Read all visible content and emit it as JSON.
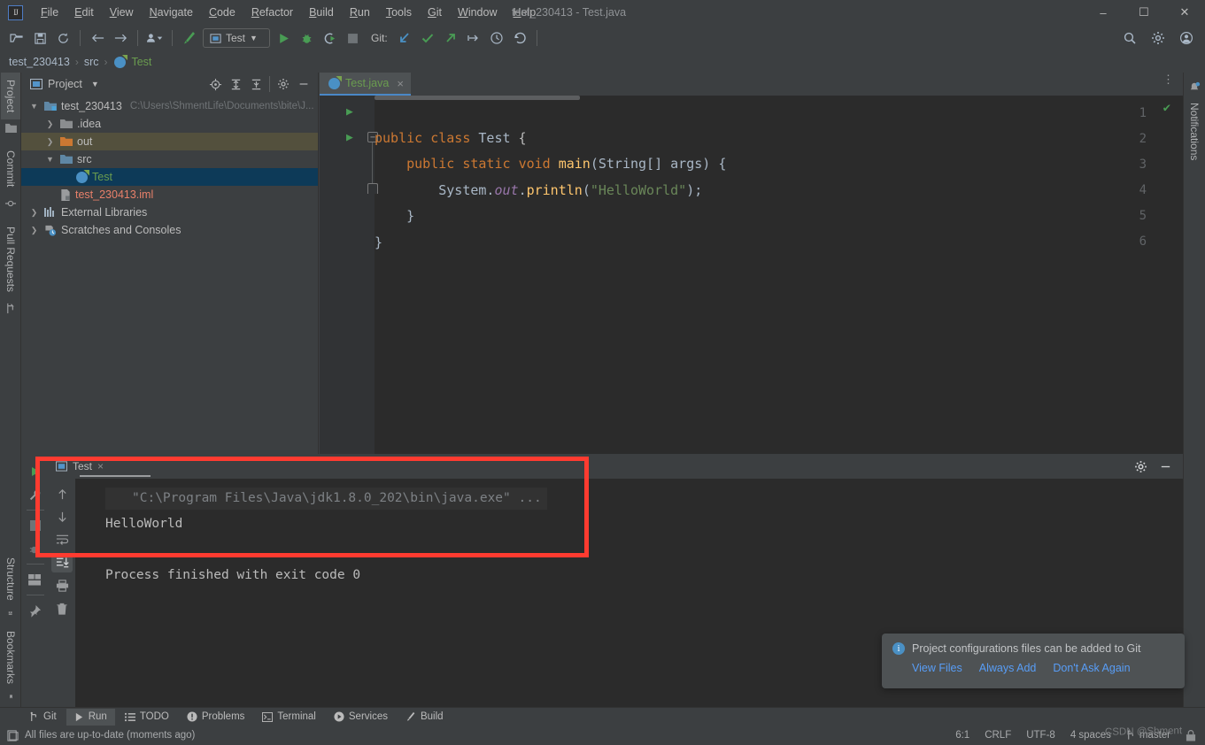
{
  "window": {
    "title": "test_230413 - Test.java",
    "minimize_label": "–",
    "maximize_label": "☐",
    "close_label": "✕"
  },
  "menu": [
    {
      "label": "File"
    },
    {
      "label": "Edit"
    },
    {
      "label": "View"
    },
    {
      "label": "Navigate"
    },
    {
      "label": "Code"
    },
    {
      "label": "Refactor"
    },
    {
      "label": "Build"
    },
    {
      "label": "Run"
    },
    {
      "label": "Tools"
    },
    {
      "label": "Git"
    },
    {
      "label": "Window"
    },
    {
      "label": "Help"
    }
  ],
  "toolbar": {
    "run_config": "Test",
    "git_label": "Git:",
    "icons": {
      "open": "open-folder-icon",
      "save": "save-icon",
      "sync": "sync-icon",
      "back": "back-arrow-icon",
      "forward": "forward-arrow-icon",
      "profile": "user-dropdown-icon",
      "build": "build-hammer-icon",
      "run": "run-icon",
      "debug": "debug-icon",
      "coverage": "run-coverage-icon",
      "stop": "stop-icon",
      "git_update": "git-update-icon",
      "git_commit": "git-commit-icon",
      "git_push": "git-push-icon",
      "git_branch": "git-branch-icon",
      "git_history": "git-history-icon",
      "git_rollback": "git-rollback-icon",
      "search": "search-icon",
      "settings": "settings-gear-icon"
    }
  },
  "breadcrumb": {
    "items": [
      "test_230413",
      "src",
      "Test"
    ],
    "separator": "›"
  },
  "rails": {
    "left_top": [
      "Project",
      "Commit",
      "Pull Requests"
    ],
    "left_bottom": [
      "Structure",
      "Bookmarks"
    ],
    "right": [
      "Notifications"
    ]
  },
  "project_panel": {
    "title": "Project",
    "tree": [
      {
        "label": "test_230413",
        "path": "C:\\Users\\ShmentLife\\Documents\\bite\\J...",
        "indent": 0,
        "arrow": "⌄",
        "icon": "project-folder-icon",
        "state": "normal"
      },
      {
        "label": ".idea",
        "path": "",
        "indent": 1,
        "arrow": "›",
        "icon": "folder-gray-icon",
        "state": "normal"
      },
      {
        "label": "out",
        "path": "",
        "indent": 1,
        "arrow": "›",
        "icon": "folder-orange-icon",
        "state": "highlighted"
      },
      {
        "label": "src",
        "path": "",
        "indent": 1,
        "arrow": "⌄",
        "icon": "folder-blue-icon",
        "state": "normal"
      },
      {
        "label": "Test",
        "path": "",
        "indent": 2,
        "arrow": "",
        "icon": "java-class-icon",
        "state": "selected"
      },
      {
        "label": "test_230413.iml",
        "path": "",
        "indent": 1,
        "arrow": "",
        "icon": "iml-file-icon",
        "state": "normal"
      },
      {
        "label": "External Libraries",
        "path": "",
        "indent": 0,
        "arrow": "›",
        "icon": "libraries-icon",
        "state": "normal"
      },
      {
        "label": "Scratches and Consoles",
        "path": "",
        "indent": 0,
        "arrow": "›",
        "icon": "scratches-icon",
        "state": "normal"
      }
    ]
  },
  "editor": {
    "tab_label": "Test.java",
    "tab_close": "×",
    "line_numbers": [
      "1",
      "2",
      "3",
      "4",
      "5",
      "6"
    ],
    "code_lines": [
      {
        "n": 1,
        "segments": [
          {
            "t": "public",
            "c": "k"
          },
          {
            "t": " ",
            "c": "pl"
          },
          {
            "t": "class",
            "c": "k"
          },
          {
            "t": " ",
            "c": "pl"
          },
          {
            "t": "Test",
            "c": "cls-n"
          },
          {
            "t": " {",
            "c": "pl"
          }
        ]
      },
      {
        "n": 2,
        "segments": [
          {
            "t": "    ",
            "c": "pl"
          },
          {
            "t": "public",
            "c": "k"
          },
          {
            "t": " ",
            "c": "pl"
          },
          {
            "t": "static",
            "c": "k"
          },
          {
            "t": " ",
            "c": "pl"
          },
          {
            "t": "void",
            "c": "k"
          },
          {
            "t": " ",
            "c": "pl"
          },
          {
            "t": "main",
            "c": "meth"
          },
          {
            "t": "(String[] args) {",
            "c": "pl"
          }
        ]
      },
      {
        "n": 3,
        "segments": [
          {
            "t": "        System.",
            "c": "pl"
          },
          {
            "t": "out",
            "c": "fld"
          },
          {
            "t": ".",
            "c": "pl"
          },
          {
            "t": "println",
            "c": "meth"
          },
          {
            "t": "(",
            "c": "pl"
          },
          {
            "t": "\"HelloWorld\"",
            "c": "str"
          },
          {
            "t": ");",
            "c": "pl"
          }
        ]
      },
      {
        "n": 4,
        "segments": [
          {
            "t": "    }",
            "c": "pl"
          }
        ]
      },
      {
        "n": 5,
        "segments": [
          {
            "t": "}",
            "c": "pl"
          }
        ]
      },
      {
        "n": 6,
        "segments": []
      }
    ],
    "inspection_status": "ok-check-icon"
  },
  "run_panel": {
    "tab_label": "Test",
    "tab_close": "×",
    "console_lines": [
      {
        "text": "\"C:\\Program Files\\Java\\jdk1.8.0_202\\bin\\java.exe\" ...",
        "kind": "command"
      },
      {
        "text": "HelloWorld",
        "kind": "output"
      },
      {
        "text": "",
        "kind": "blank"
      },
      {
        "text": "Process finished with exit code 0",
        "kind": "output"
      }
    ],
    "rail_icons": [
      "rerun-icon",
      "wrench-icon",
      "stop-icon",
      "debug-rerun-icon",
      "layout-icon",
      "pin-icon"
    ],
    "console_icons": [
      "scroll-up-icon",
      "scroll-down-icon",
      "soft-wrap-icon",
      "scroll-to-end-icon",
      "print-icon",
      "trash-icon"
    ],
    "header_icons": [
      "settings-gear-icon",
      "hide-icon"
    ]
  },
  "notification": {
    "icon": "info-icon",
    "message": "Project configurations files can be added to Git",
    "actions": [
      "View Files",
      "Always Add",
      "Don't Ask Again"
    ]
  },
  "tool_windows": [
    {
      "label": "Git",
      "icon": "git-branch-icon",
      "active": false
    },
    {
      "label": "Run",
      "icon": "run-icon",
      "active": true
    },
    {
      "label": "TODO",
      "icon": "todo-icon",
      "active": false
    },
    {
      "label": "Problems",
      "icon": "problems-icon",
      "active": false
    },
    {
      "label": "Terminal",
      "icon": "terminal-icon",
      "active": false
    },
    {
      "label": "Services",
      "icon": "services-icon",
      "active": false
    },
    {
      "label": "Build",
      "icon": "build-hammer-icon",
      "active": false
    }
  ],
  "status_bar": {
    "message": "All files are up-to-date (moments ago)",
    "message_icon": "file-status-icon",
    "caret_position": "6:1",
    "line_separator": "CRLF",
    "encoding": "UTF-8",
    "indent": "4 spaces",
    "branch": "master",
    "branch_icon": "git-branch-icon",
    "lock_icon": "read-only-icon"
  },
  "watermark": "CSDN @Shment",
  "colors": {
    "bg_chrome": "#3c3f41",
    "bg_editor": "#2b2b2b",
    "accent_blue": "#4a88c7",
    "keyword_orange": "#cc7832",
    "string_green": "#6a8759",
    "method_yellow": "#ffc66d",
    "field_purple": "#9876aa",
    "run_green": "#499c54",
    "selection_blue": "#0d3a58",
    "highlight_olive": "#53503d",
    "redbox": "#ff3b30",
    "link_blue": "#589df6"
  }
}
